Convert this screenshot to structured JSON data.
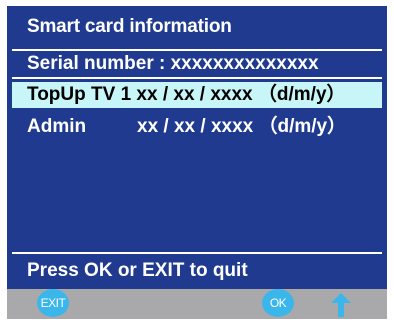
{
  "screen": {
    "title": "Smart card information",
    "serial_label": "Serial number : xxxxxxxxxxxxxx",
    "topup_label": "TopUp TV 1 xx / xx / xxxx （d/m/y）",
    "admin_label": "Admin",
    "admin_value": "xx / xx / xxxx （d/m/y）",
    "footer": "Press OK or EXIT to quit"
  },
  "buttons": {
    "exit_label": "EXIT",
    "ok_label": "OK",
    "arrow_icon": "up-arrow-icon"
  },
  "colors": {
    "panel_bg": "#1f3a8f",
    "highlight_bg": "#c8f6f8",
    "button_color": "#3bb6ea",
    "bottom_bar": "#a9a9ab"
  }
}
